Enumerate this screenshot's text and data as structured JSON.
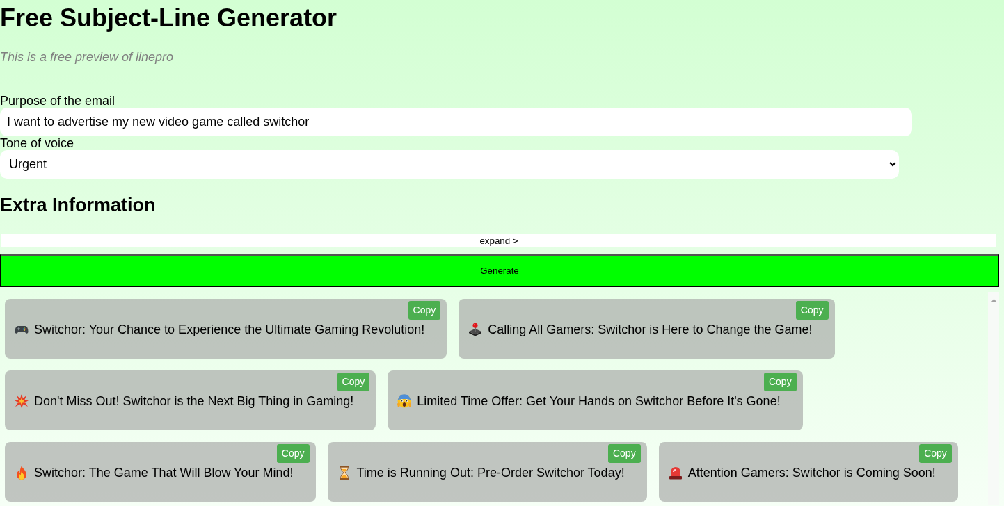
{
  "title": "Free Subject-Line Generator",
  "subtitle": "This is a free preview of linepro",
  "form": {
    "purpose": {
      "label": "Purpose of the email",
      "value": "I want to advertise my new video game called switchor"
    },
    "tone": {
      "label": "Tone of voice",
      "value": "Urgent"
    }
  },
  "extra_information": {
    "heading": "Extra Information",
    "toggle": "expand >"
  },
  "generate_button": "Generate",
  "subject_lines": [
    {
      "kind": "gamepad",
      "text": "Switchor: Your Chance to Experience the Ultimate Gaming Revolution!",
      "button": "Copy"
    },
    {
      "kind": "joystick",
      "text": "Calling All Gamers: Switchor is Here to Change the Game!",
      "button": "Copy"
    },
    {
      "kind": "collision",
      "text": "Don't Miss Out! Switchor is the Next Big Thing in Gaming!",
      "button": "Copy"
    },
    {
      "kind": "shocked-face",
      "text": "Limited Time Offer: Get Your Hands on Switchor Before It's Gone!",
      "button": "Copy"
    },
    {
      "kind": "fire",
      "text": "Switchor: The Game That Will Blow Your Mind!",
      "button": "Copy"
    },
    {
      "kind": "hourglass",
      "text": "Time is Running Out: Pre-Order Switchor Today!",
      "button": "Copy"
    },
    {
      "kind": "siren",
      "text": "Attention Gamers: Switchor is Coming Soon!",
      "button": "Copy"
    }
  ]
}
